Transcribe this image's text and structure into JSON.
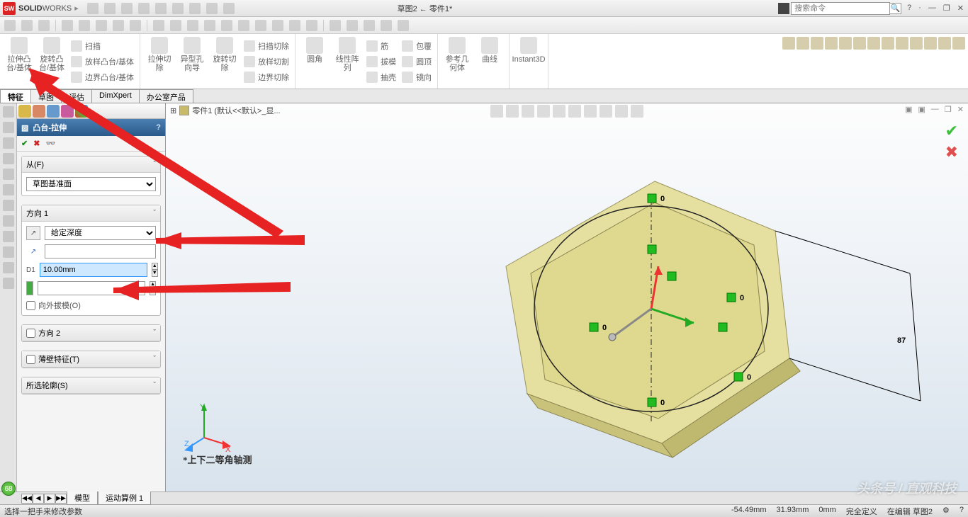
{
  "title": {
    "brand": "SOLIDWORKS",
    "doc": "草图2 ← 零件1*"
  },
  "search": {
    "placeholder": "搜索命令"
  },
  "winbtns": {
    "help": "?",
    "min": "—",
    "max": "❐",
    "close": "✕"
  },
  "ribbon": {
    "g1": {
      "a": "拉伸凸台/基体",
      "b": "旋转凸台/基体",
      "c1": "扫描",
      "c2": "放样凸台/基体",
      "c3": "边界凸台/基体"
    },
    "g2": {
      "a": "拉伸切除",
      "b": "异型孔向导",
      "c": "旋转切除",
      "d1": "扫描切除",
      "d2": "放样切割",
      "d3": "边界切除"
    },
    "g3": {
      "a": "圆角",
      "b": "线性阵列",
      "c1": "筋",
      "c2": "拔模",
      "c3": "抽壳",
      "d1": "包覆",
      "d2": "圆顶",
      "d3": "镜向"
    },
    "g4": {
      "a": "参考几何体",
      "b": "曲线"
    },
    "g5": {
      "a": "Instant3D"
    }
  },
  "tabs": {
    "a": "特征",
    "b": "草图",
    "c": "评估",
    "d": "DimXpert",
    "e": "办公室产品"
  },
  "tree": {
    "root": "零件1 (默认<<默认>_显..."
  },
  "pm": {
    "title": "凸台-拉伸",
    "help": "?",
    "ok": "✔",
    "cancel": "✖",
    "glasses": "👓",
    "from": {
      "label": "从(F)",
      "value": "草图基准面"
    },
    "dir1": {
      "label": "方向 1",
      "type": "给定深度",
      "depth": "10.00mm",
      "depth_icon": "D1",
      "draft": "向外拔模(O)"
    },
    "dir2": {
      "label": "方向 2"
    },
    "thin": {
      "label": "薄壁特征(T)"
    },
    "contour": {
      "label": "所选轮廓(S)"
    }
  },
  "viewport": {
    "label": "*上下二等角轴测",
    "ok": "✔",
    "no": "✖",
    "dim": "87",
    "zero": "0"
  },
  "btabs": {
    "a": "模型",
    "b": "运动算例 1",
    "l": "◀",
    "ll": "◀◀",
    "r": "▶",
    "rr": "▶▶"
  },
  "status": {
    "msg": "选择一把手来修改参数",
    "x": "-54.49mm",
    "y": "31.93mm",
    "z": "0mm",
    "def": "完全定义",
    "edit": "在编辑 草图2"
  },
  "badge": "68",
  "watermark": "头条号 / 直观科技"
}
